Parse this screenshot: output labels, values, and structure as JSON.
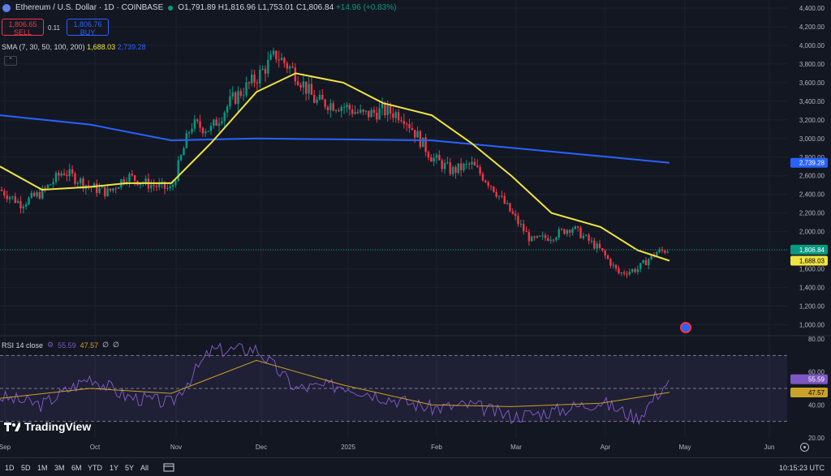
{
  "header": {
    "symbol": "Ethereum / U.S. Dollar · 1D · COINBASE",
    "open": "O1,791.89",
    "high": "H1,816.96",
    "low": "L1,753.01",
    "close": "C1,806.84",
    "change": "+14.96 (+0.83%)"
  },
  "trade": {
    "sell_price": "1,806.65",
    "sell_label": "SELL",
    "spread": "0.11",
    "buy_price": "1,806.76",
    "buy_label": "BUY"
  },
  "sma_legend": {
    "label": "SMA (7, 30, 50, 100, 200)",
    "v1": "1,688.03",
    "v2": "2,739.28"
  },
  "rsi_legend": {
    "label": "RSI 14 close",
    "v1": "55.59",
    "v2": "47.57",
    "v3": "∅",
    "v4": "∅"
  },
  "logo": "TradingView",
  "toolbar": {
    "ranges": [
      "1D",
      "5D",
      "1M",
      "3M",
      "6M",
      "YTD",
      "1Y",
      "5Y",
      "All"
    ],
    "clock": "10:15:23 UTC"
  },
  "colors": {
    "bg": "#131722",
    "up": "#089981",
    "down": "#f23645",
    "sma_fast": "#f0e442",
    "sma_slow": "#2962ff",
    "rsi": "#7e57c2",
    "rsi_ma": "#c9a227"
  },
  "chart_data": [
    {
      "type": "candlestick",
      "title": "Ethereum / U.S. Dollar · 1D · COINBASE",
      "ylim": [
        900,
        4400
      ],
      "yticks": [
        1000,
        1200,
        1400,
        1600,
        1800,
        2000,
        2200,
        2400,
        2600,
        2800,
        3000,
        3200,
        3400,
        3600,
        3800,
        4000,
        4200,
        4400
      ],
      "ytick_labels": [
        "1,000.00",
        "1,200.00",
        "1,400.00",
        "1,600.00",
        "1,800.00",
        "2,000.00",
        "2,200.00",
        "2,400.00",
        "2,600.00",
        "2,800.00",
        "3,000.00",
        "3,200.00",
        "3,400.00",
        "3,600.00",
        "3,800.00",
        "4,000.00",
        "4,200.00",
        "4,400.00"
      ],
      "xticks": [
        "Sep",
        "Oct",
        "Nov",
        "Dec",
        "2025",
        "Feb",
        "Mar",
        "Apr",
        "May",
        "Jun"
      ],
      "close_series": {
        "x": [
          "Sep 1",
          "Sep 8",
          "Sep 15",
          "Sep 22",
          "Oct 1",
          "Oct 8",
          "Oct 15",
          "Oct 22",
          "Nov 1",
          "Nov 8",
          "Nov 15",
          "Nov 22",
          "Dec 1",
          "Dec 8",
          "Dec 15",
          "Dec 22",
          "Jan 1",
          "Jan 8",
          "Jan 15",
          "Jan 22",
          "Feb 1",
          "Feb 8",
          "Feb 15",
          "Feb 22",
          "Mar 1",
          "Mar 8",
          "Mar 15",
          "Mar 22",
          "Apr 1",
          "Apr 8",
          "Apr 15",
          "Apr 22",
          "Apr 27"
        ],
        "values": [
          2450,
          2300,
          2420,
          2650,
          2480,
          2420,
          2600,
          2520,
          2450,
          3150,
          3100,
          3400,
          3650,
          3900,
          3700,
          3400,
          3350,
          3250,
          3300,
          3250,
          2800,
          2650,
          2720,
          2500,
          2200,
          1900,
          1950,
          2050,
          1800,
          1550,
          1600,
          1780,
          1806.84
        ]
      },
      "sma_fast": {
        "name": "SMA",
        "x": [
          "Sep 1",
          "Sep 15",
          "Oct 1",
          "Oct 15",
          "Nov 1",
          "Nov 15",
          "Dec 1",
          "Dec 15",
          "Jan 1",
          "Jan 15",
          "Feb 1",
          "Feb 15",
          "Mar 1",
          "Mar 15",
          "Apr 1",
          "Apr 15",
          "Apr 27"
        ],
        "values": [
          2700,
          2450,
          2480,
          2520,
          2520,
          2950,
          3500,
          3700,
          3600,
          3380,
          3250,
          2950,
          2600,
          2200,
          2050,
          1800,
          1688.03
        ]
      },
      "sma_slow": {
        "name": "SMA",
        "x": [
          "Sep 1",
          "Oct 1",
          "Nov 1",
          "Dec 1",
          "Jan 1",
          "Feb 1",
          "Mar 1",
          "Apr 1",
          "Apr 27"
        ],
        "values": [
          3250,
          3150,
          2980,
          3000,
          2990,
          2980,
          2900,
          2810,
          2739.28
        ]
      },
      "last_price_label": "1,806.84",
      "sma_fast_label": "1,688.03",
      "sma_slow_label": "2,739.28"
    },
    {
      "type": "line",
      "title": "RSI 14 close",
      "ylim": [
        20,
        80
      ],
      "yticks": [
        20,
        40,
        60,
        80
      ],
      "ytick_labels": [
        "20.00",
        "40.00",
        "60.00",
        "80.00"
      ],
      "band": [
        30,
        70
      ],
      "midline": 50,
      "rsi": {
        "x": [
          "Sep 1",
          "Sep 15",
          "Oct 1",
          "Oct 15",
          "Nov 1",
          "Nov 15",
          "Dec 1",
          "Dec 15",
          "Jan 1",
          "Jan 15",
          "Feb 1",
          "Feb 15",
          "Mar 1",
          "Mar 15",
          "Apr 1",
          "Apr 15",
          "Apr 27"
        ],
        "values": [
          45,
          40,
          57,
          45,
          41,
          73,
          74,
          50,
          52,
          45,
          38,
          40,
          33,
          36,
          42,
          32,
          55.59
        ]
      },
      "rsi_ma": {
        "x": [
          "Sep 1",
          "Oct 1",
          "Nov 1",
          "Dec 1",
          "Jan 1",
          "Feb 1",
          "Mar 1",
          "Apr 1",
          "Apr 27"
        ],
        "values": [
          44,
          50,
          47,
          67,
          52,
          40,
          39,
          41,
          47.57
        ]
      },
      "rsi_label": "55.59",
      "rsi_ma_label": "47.57"
    }
  ]
}
